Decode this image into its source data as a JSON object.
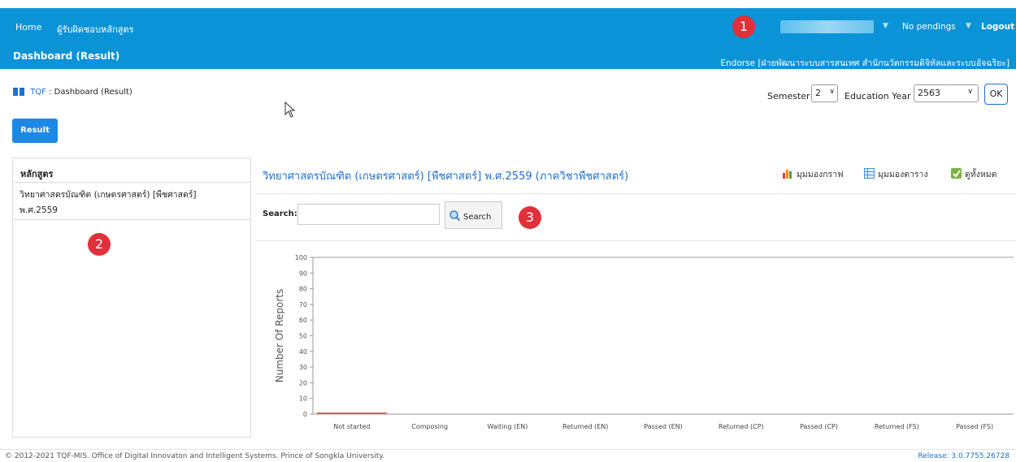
{
  "topbar": {
    "nav_home": "Home",
    "nav_curriculum": "ผู้รับผิดชอบหลักสูตร",
    "page_title": "Dashboard (Result)",
    "pendings": "No pendings",
    "logout": "Logout",
    "endorse": "Endorse [ฝ่ายพัฒนาระบบสารสนเทศ สำนักนวัตกรรมดิจิทัลและระบบอัจฉริยะ]",
    "marker": "1"
  },
  "breadcrumb": {
    "root": "TQF",
    "sep": " : ",
    "current": "Dashboard (Result)"
  },
  "filters": {
    "semester_label": "Semester",
    "semester_value": "2",
    "year_label": "Education Year",
    "year_value": "2563",
    "ok": "OK"
  },
  "result_button": "Result",
  "left_panel": {
    "header": "หลักสูตร",
    "item_line1": "วิทยาศาสตรบัณฑิต (เกษตรศาสตร์) [พืชศาสตร์]",
    "item_line2": "พ.ศ.2559",
    "marker": "2"
  },
  "main": {
    "title": "วิทยาศาสตรบัณฑิต (เกษตรศาสตร์) [พืชศาสตร์] พ.ศ.2559 (ภาควิชาพืชศาสตร์)",
    "view_graph": "มุมมองกราฟ",
    "view_table": "มุมมองตาราง",
    "view_all": "ดูทั้งหมด",
    "search_label": "Search:",
    "search_value": "",
    "search_button": "Search",
    "marker": "3"
  },
  "chart_data": {
    "type": "bar",
    "ylabel": "Number Of Reports",
    "ylim": [
      0,
      100
    ],
    "yticks": [
      "0",
      "10",
      "20",
      "30",
      "40",
      "50",
      "60",
      "70",
      "80",
      "90",
      "100"
    ],
    "categories": [
      "Not started",
      "Composing",
      "Waiting (EN)",
      "Returned (EN)",
      "Passed (EN)",
      "Returned (CP)",
      "Passed (CP)",
      "Returned (FS)",
      "Passed (FS)"
    ],
    "values": [
      1,
      0,
      0,
      0,
      0,
      0,
      0,
      0,
      0
    ],
    "bar_color": "#e05a5a"
  },
  "footer": {
    "copyright": "© 2012-2021 TQF-MIS. Office of Digital Innovaton and Intelligent Systems. Prince of Songkla University.",
    "release": "Release: 3.0.7755.26728"
  }
}
